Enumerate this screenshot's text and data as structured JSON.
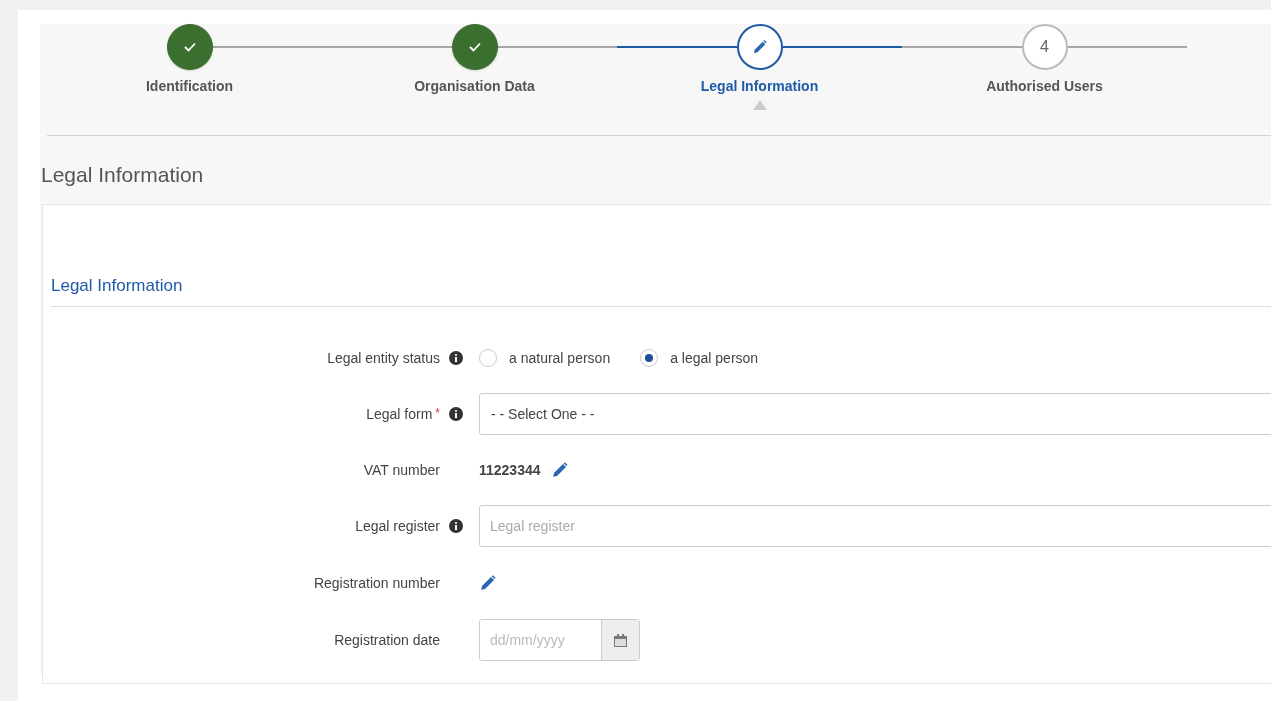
{
  "steps": [
    {
      "label": "Identification",
      "done": true,
      "selected": false
    },
    {
      "label": "Organisation Data",
      "done": true,
      "selected": false
    },
    {
      "label": "Legal Information",
      "done": false,
      "selected": true
    },
    {
      "label": "Authorised Users",
      "done": false,
      "selected": false,
      "number": "4"
    }
  ],
  "page_title": "Legal Information",
  "section_title": "Legal Information",
  "fields": [
    {
      "kind": "radio",
      "label": "Legal entity status",
      "info": true,
      "options": [
        {
          "label": "a natural person",
          "selected": false
        },
        {
          "label": "a legal person",
          "selected": true
        }
      ]
    },
    {
      "kind": "select",
      "label": "Legal form",
      "required_mark": "*",
      "info": true,
      "value": "- - Select One - -"
    },
    {
      "kind": "readonly",
      "label": "VAT number",
      "value": "11223344",
      "editable": true
    },
    {
      "kind": "text",
      "label": "Legal register",
      "info": true,
      "placeholder": "Legal register"
    },
    {
      "kind": "readonly",
      "label": "Registration number",
      "editable": true
    },
    {
      "kind": "date",
      "label": "Registration date",
      "placeholder": "dd/mm/yyyy"
    }
  ]
}
